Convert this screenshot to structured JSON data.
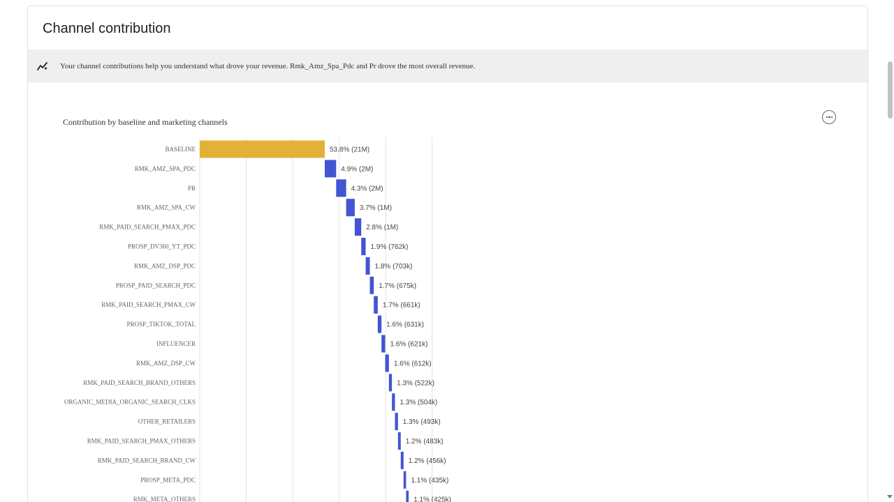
{
  "card": {
    "title": "Channel contribution"
  },
  "insight": {
    "icon": "trending-sparkle-icon",
    "text": "Your channel contributions help you understand what drove your revenue. Rmk_Amz_Spa_Pdc and Pr drove the most overall revenue."
  },
  "menu": {
    "icon": "more-horizontal-icon"
  },
  "chart_data": {
    "type": "bar",
    "subtype": "horizontal waterfall",
    "title": "Contribution by baseline and marketing channels",
    "xlabel": "",
    "ylabel": "",
    "xlim": [
      0,
      100
    ],
    "grid": true,
    "legend": "none",
    "categories": [
      "BASELINE",
      "RMK_AMZ_SPA_PDC",
      "PR",
      "RMK_AMZ_SPA_CW",
      "RMK_PAID_SEARCH_PMAX_PDC",
      "PROSP_DV360_YT_PDC",
      "RMK_AMZ_DSP_PDC",
      "PROSP_PAID_SEARCH_PDC",
      "RMK_PAID_SEARCH_PMAX_CW",
      "PROSP_TIKTOK_TOTAL",
      "INFLUENCER",
      "RMK_AMZ_DSP_CW",
      "RMK_PAID_SEARCH_BRAND_OTHERS",
      "ORGANIC_MEDIA_ORGANIC_SEARCH_CLKS",
      "OTHER_RETAILERS",
      "RMK_PAID_SEARCH_PMAX_OTHERS",
      "RMK_PAID_SEARCH_BRAND_CW",
      "PROSP_META_PDC",
      "RMK_META_OTHERS"
    ],
    "values": [
      53.8,
      4.9,
      4.3,
      3.7,
      2.8,
      1.9,
      1.8,
      1.7,
      1.7,
      1.6,
      1.6,
      1.6,
      1.3,
      1.3,
      1.3,
      1.2,
      1.2,
      1.1,
      1.1
    ],
    "data_labels": [
      "53.8% (21M)",
      "4.9% (2M)",
      "4.3% (2M)",
      "3.7% (1M)",
      "2.8% (1M)",
      "1.9% (762k)",
      "1.8% (703k)",
      "1.7% (675k)",
      "1.7% (661k)",
      "1.6% (631k)",
      "1.6% (621k)",
      "1.6% (612k)",
      "1.3% (522k)",
      "1.3% (504k)",
      "1.3% (493k)",
      "1.2% (483k)",
      "1.2% (456k)",
      "1.1% (435k)",
      "1.1% (425k)"
    ],
    "colors": {
      "baseline": "#e3b137",
      "channel": "#4355d1",
      "grid": "#e3e3e3"
    }
  }
}
